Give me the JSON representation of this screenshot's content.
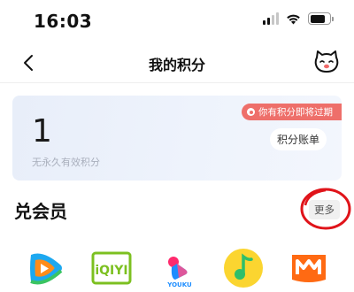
{
  "status_bar": {
    "time": "16:03",
    "icons": [
      "cellular-signal-icon",
      "wifi-icon",
      "battery-icon"
    ]
  },
  "nav": {
    "title": "我的积分",
    "back_icon": "chevron-left-icon",
    "mascot_icon": "cat-mascot-icon"
  },
  "points_card": {
    "value": "1",
    "description": "无永久有效积分",
    "expire_notice": "你有积分即将过期",
    "ledger_button": "积分账单"
  },
  "redeem_section": {
    "title": "兑会员",
    "more_button": "更多",
    "apps": [
      {
        "name": "tencent-video-logo"
      },
      {
        "name": "iqiyi-logo",
        "text": "iQIYI"
      },
      {
        "name": "youku-logo",
        "text": "YOUKU"
      },
      {
        "name": "qq-music-logo"
      },
      {
        "name": "mango-tv-logo"
      }
    ]
  },
  "colors": {
    "accent_red": "#ee6f6a",
    "annotation_red": "#e0141a",
    "card_bg": "#e8eef9"
  }
}
